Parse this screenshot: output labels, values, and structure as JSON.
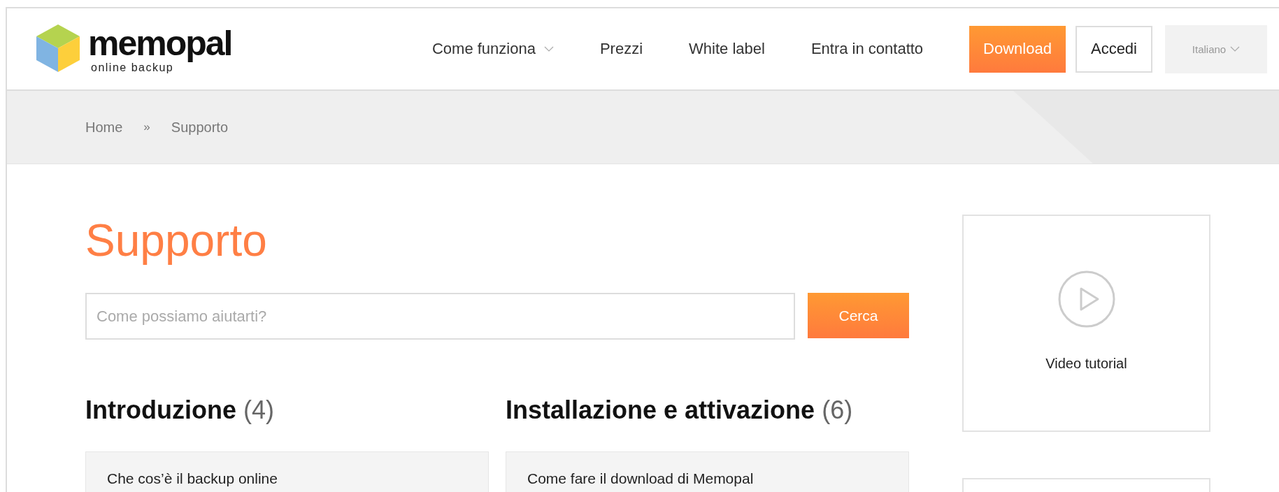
{
  "logo": {
    "name": "memopal",
    "tagline": "online backup"
  },
  "nav": [
    {
      "label": "Come funziona",
      "dropdown": true
    },
    {
      "label": "Prezzi",
      "dropdown": false
    },
    {
      "label": "White label",
      "dropdown": false
    },
    {
      "label": "Entra in contatto",
      "dropdown": false
    }
  ],
  "download_button": "Download",
  "login_button": "Accedi",
  "language": {
    "label": "Italiano",
    "dropdown": true
  },
  "breadcrumb": {
    "items": [
      "Home",
      "Supporto"
    ],
    "separator": "»"
  },
  "title": "Supporto",
  "search": {
    "placeholder": "Come possiamo aiutarti?",
    "button": "Cerca"
  },
  "categories": [
    {
      "title": "Introduzione",
      "count": "(4)",
      "articles": [
        "Che cos’è il backup online"
      ]
    },
    {
      "title": "Installazione e attivazione",
      "count": "(6)",
      "articles": [
        "Come fare il download di Memopal"
      ]
    }
  ],
  "sidebar": [
    {
      "kind": "video",
      "label": "Video tutorial"
    },
    {
      "kind": "blank"
    }
  ]
}
